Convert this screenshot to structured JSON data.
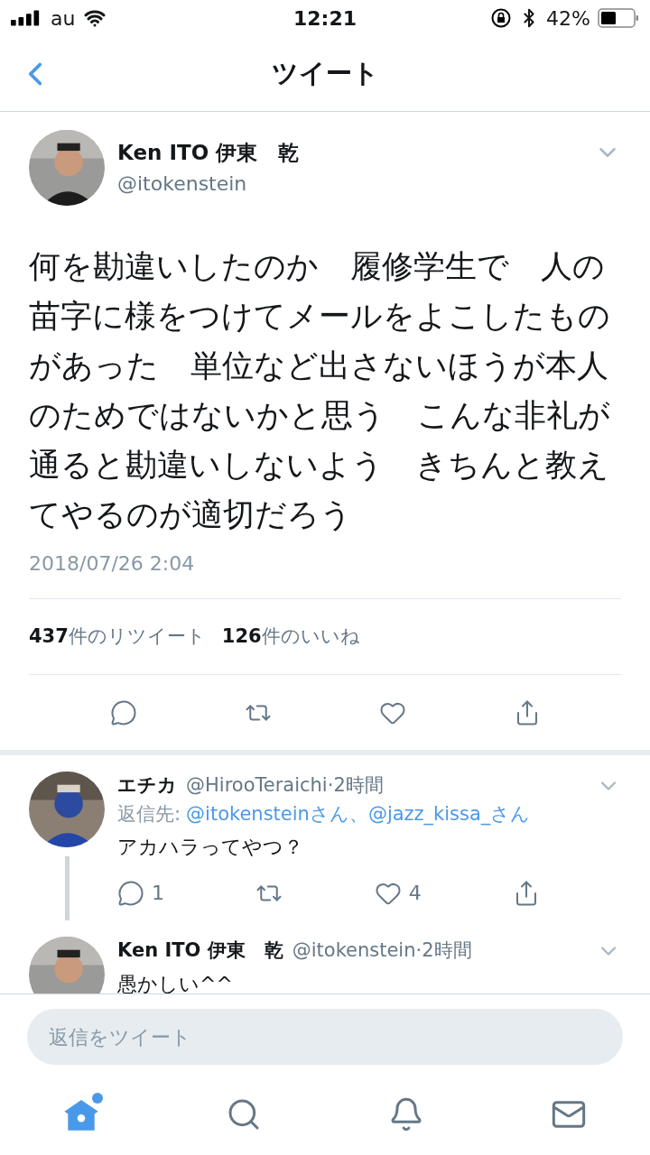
{
  "status_bar": {
    "carrier": "au",
    "time": "12:21",
    "battery": "42%"
  },
  "nav": {
    "title": "ツイート"
  },
  "tweet": {
    "name": "Ken ITO 伊東　乾",
    "handle": "@itokenstein",
    "text": "何を勘違いしたのか　履修学生で　人の苗字に様をつけてメールをよこしたものがあった　単位など出さないほうが本人のためではないかと思う　こんな非礼が通ると勘違いしないよう　きちんと教えてやるのが適切だろう",
    "date": "2018/07/26 2:04",
    "stats": [
      "**437**件のリツイート",
      "**126**件のいいね"
    ]
  },
  "replies": [
    {
      "name": "エチカ",
      "meta": "@HirooTeraichi·2時間",
      "reply_to_label": "返信先:",
      "reply_to": "@itokensteinさん、@jazz_kissa_さん",
      "text": "アカハラってやつ？",
      "reply_count": "1",
      "like_count": "4",
      "thread_line": true
    },
    {
      "name": "Ken ITO 伊東　乾",
      "meta": "@itokenstein·2時間",
      "text": "愚かしい^^",
      "thread_line": false
    }
  ],
  "compose": {
    "placeholder": "返信をツイート"
  },
  "tabs": [
    {
      "kind": "home",
      "selected": true,
      "has_new": true
    },
    {
      "kind": "search",
      "selected": false,
      "has_new": false
    },
    {
      "kind": "notifications",
      "selected": false,
      "has_new": false
    },
    {
      "kind": "messages",
      "selected": false,
      "has_new": false
    }
  ]
}
